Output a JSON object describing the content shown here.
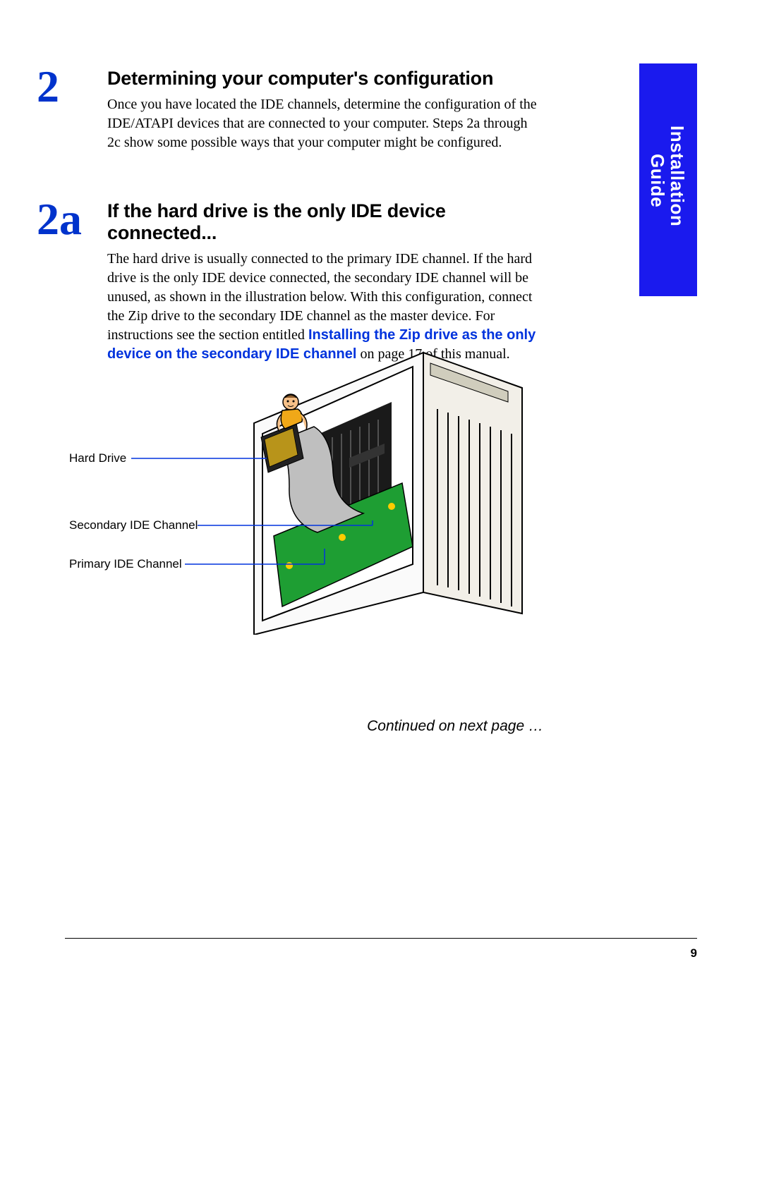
{
  "sideTab": {
    "line1": "Installation",
    "line2": "Guide"
  },
  "step2": {
    "number": "2",
    "heading": "Determining your computer's configuration",
    "body": "Once you have located the IDE channels, determine the configuration of the IDE/ATAPI devices that are connected to your computer.  Steps 2a through 2c show some possible ways that your computer might be configured."
  },
  "step2a": {
    "number": "2a",
    "heading": "If the hard drive is the only IDE device connected...",
    "body_pre": "The hard drive is usually connected to the primary IDE channel. If the hard drive is the only IDE device connected, the secondary IDE channel will be unused, as shown in the illustration below.  With this configuration, connect the Zip drive to the secondary IDE channel as the master device.  For instructions see the section entitled ",
    "link": "Installing the Zip drive as the only device on the secondary IDE channel",
    "body_post": " on page 17 of this manual."
  },
  "callouts": {
    "hardDrive": "Hard Drive",
    "secondary": "Secondary IDE Channel",
    "primary": "Primary IDE Channel"
  },
  "continued": "Continued on next page …",
  "pageNumber": "9"
}
